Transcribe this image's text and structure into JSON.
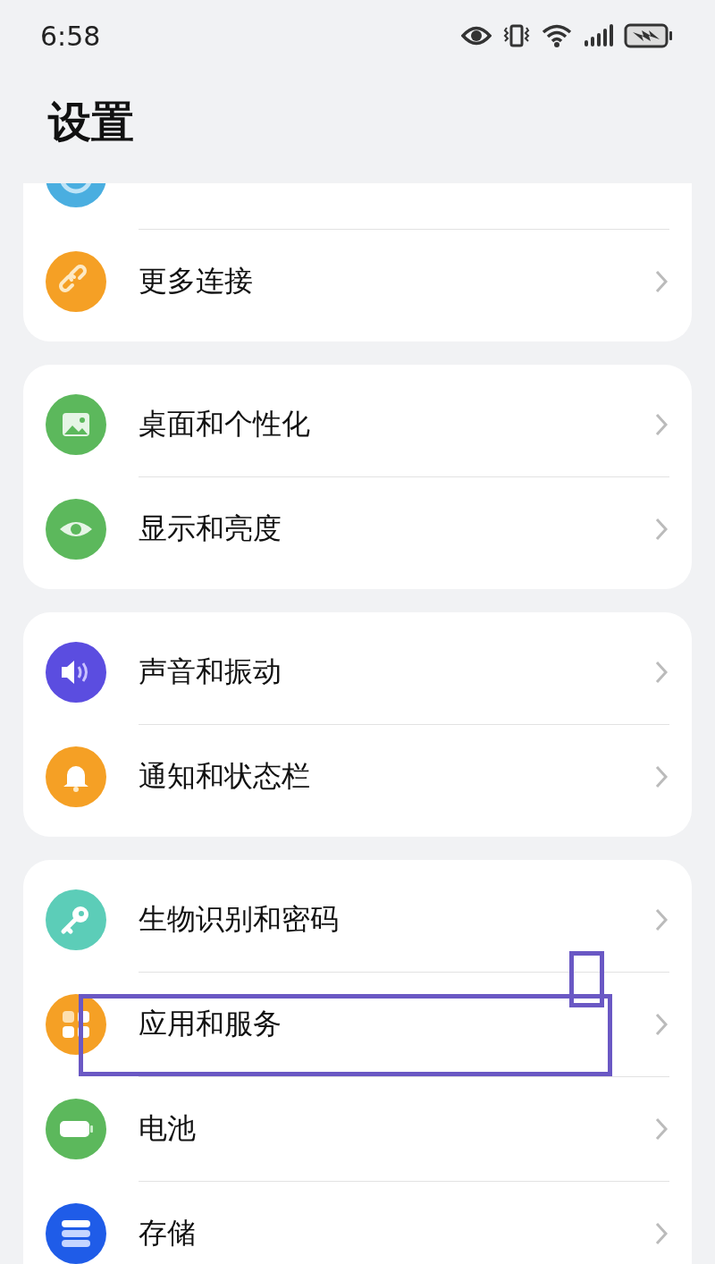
{
  "status_bar": {
    "time": "6:58",
    "battery_charging": true
  },
  "title": "设置",
  "groups": [
    {
      "items": [
        {
          "kind": "rings",
          "color": "#4aaee0"
        },
        {
          "kind": "link",
          "color": "#f5a025",
          "label": "更多连接"
        }
      ]
    },
    {
      "items": [
        {
          "kind": "picture",
          "color": "#5cb85c",
          "label": "桌面和个性化"
        },
        {
          "kind": "eye",
          "color": "#5cb85c",
          "label": "显示和亮度"
        }
      ]
    },
    {
      "items": [
        {
          "kind": "speaker",
          "color": "#5b4de0",
          "label": "声音和振动"
        },
        {
          "kind": "bell",
          "color": "#f5a025",
          "label": "通知和状态栏"
        }
      ]
    },
    {
      "items": [
        {
          "kind": "key",
          "color": "#5ccdb8",
          "label": "生物识别和密码"
        },
        {
          "kind": "apps",
          "color": "#f5a025",
          "label": "应用和服务"
        },
        {
          "kind": "battery",
          "color": "#5cb85c",
          "label": "电池"
        },
        {
          "kind": "storage",
          "color": "#1f5ce8",
          "label": "存储"
        }
      ]
    }
  ],
  "highlight": {
    "color": "#6a58c4"
  }
}
